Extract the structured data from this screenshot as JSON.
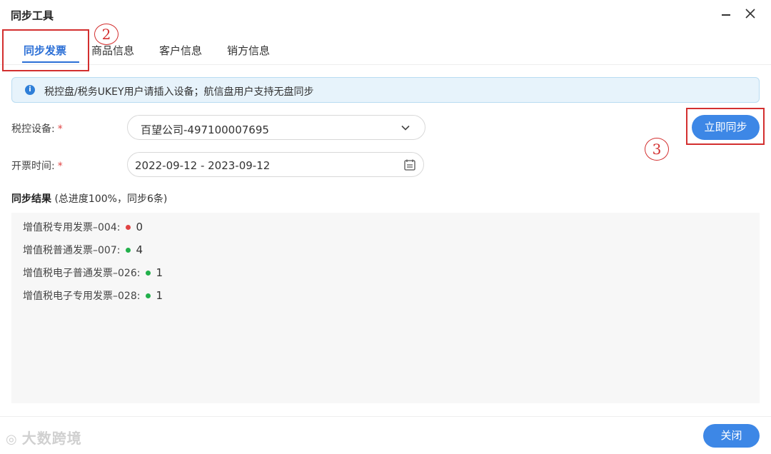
{
  "window": {
    "title": "同步工具",
    "minimize_icon": "minimize-icon",
    "close_icon": "close-icon"
  },
  "tabs": [
    {
      "label": "同步发票",
      "active": true
    },
    {
      "label": "商品信息",
      "active": false
    },
    {
      "label": "客户信息",
      "active": false
    },
    {
      "label": "销方信息",
      "active": false
    }
  ],
  "annotations": {
    "tab_marker": "2",
    "button_marker": "3",
    "color": "#d32f2f"
  },
  "notice": {
    "icon": "info-icon",
    "text": "税控盘/税务UKEY用户请插入设备；航信盘用户支持无盘同步"
  },
  "form": {
    "device_label": "税控设备:",
    "device_value": "百望公司-497100007695",
    "date_label": "开票时间:",
    "date_value": "2022-09-12 - 2023-09-12",
    "required_mark": "*"
  },
  "sync_button_label": "立即同步",
  "result": {
    "heading": "同步结果",
    "summary": "(总进度100%，同步6条)",
    "rows": [
      {
        "label": "增值税专用发票–004:",
        "status_color": "#e04343",
        "count": "0"
      },
      {
        "label": "增值税普通发票–007:",
        "status_color": "#22b04b",
        "count": "4"
      },
      {
        "label": "增值税电子普通发票–026:",
        "status_color": "#22b04b",
        "count": "1"
      },
      {
        "label": "增值税电子专用发票–028:",
        "status_color": "#22b04b",
        "count": "1"
      }
    ]
  },
  "footer": {
    "close_label": "关闭",
    "watermark": "大数跨境"
  },
  "colors": {
    "accent": "#2b6fd6",
    "button": "#3d87e6",
    "notice_bg": "#e7f3fb"
  }
}
